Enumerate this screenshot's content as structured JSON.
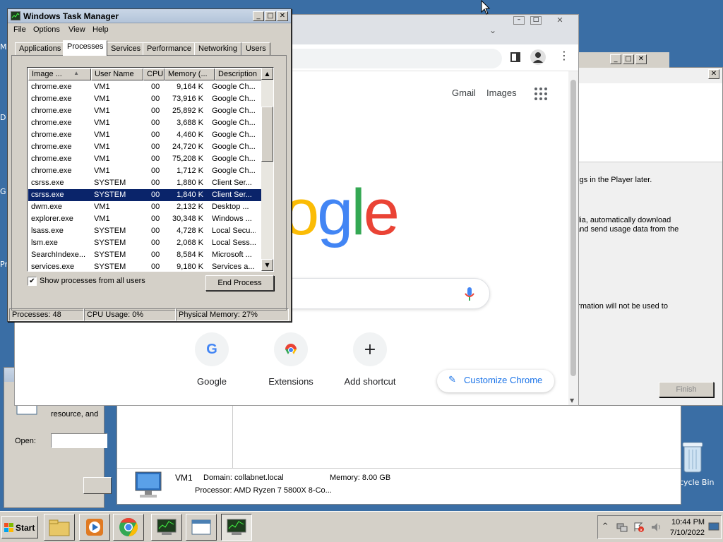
{
  "task_manager": {
    "title": "Windows Task Manager",
    "menu": [
      "File",
      "Options",
      "View",
      "Help"
    ],
    "tabs": [
      "Applications",
      "Processes",
      "Services",
      "Performance",
      "Networking",
      "Users"
    ],
    "columns": [
      "Image ...",
      "User Name",
      "CPU",
      "Memory (...",
      "Description"
    ],
    "processes": [
      {
        "image": "chrome.exe",
        "user": "VM1",
        "cpu": "00",
        "memory": "9,164 K",
        "description": "Google Ch..."
      },
      {
        "image": "chrome.exe",
        "user": "VM1",
        "cpu": "00",
        "memory": "73,916 K",
        "description": "Google Ch..."
      },
      {
        "image": "chrome.exe",
        "user": "VM1",
        "cpu": "00",
        "memory": "25,892 K",
        "description": "Google Ch..."
      },
      {
        "image": "chrome.exe",
        "user": "VM1",
        "cpu": "00",
        "memory": "3,688 K",
        "description": "Google Ch..."
      },
      {
        "image": "chrome.exe",
        "user": "VM1",
        "cpu": "00",
        "memory": "4,460 K",
        "description": "Google Ch..."
      },
      {
        "image": "chrome.exe",
        "user": "VM1",
        "cpu": "00",
        "memory": "24,720 K",
        "description": "Google Ch..."
      },
      {
        "image": "chrome.exe",
        "user": "VM1",
        "cpu": "00",
        "memory": "75,208 K",
        "description": "Google Ch..."
      },
      {
        "image": "chrome.exe",
        "user": "VM1",
        "cpu": "00",
        "memory": "1,712 K",
        "description": "Google Ch..."
      },
      {
        "image": "csrss.exe",
        "user": "SYSTEM",
        "cpu": "00",
        "memory": "1,880 K",
        "description": "Client Ser..."
      },
      {
        "image": "csrss.exe",
        "user": "SYSTEM",
        "cpu": "00",
        "memory": "1,840 K",
        "description": "Client Ser..."
      },
      {
        "image": "dwm.exe",
        "user": "VM1",
        "cpu": "00",
        "memory": "2,132 K",
        "description": "Desktop ..."
      },
      {
        "image": "explorer.exe",
        "user": "VM1",
        "cpu": "00",
        "memory": "30,348 K",
        "description": "Windows ..."
      },
      {
        "image": "lsass.exe",
        "user": "SYSTEM",
        "cpu": "00",
        "memory": "4,728 K",
        "description": "Local Secu..."
      },
      {
        "image": "lsm.exe",
        "user": "SYSTEM",
        "cpu": "00",
        "memory": "2,068 K",
        "description": "Local Sess..."
      },
      {
        "image": "SearchIndexe...",
        "user": "SYSTEM",
        "cpu": "00",
        "memory": "8,584 K",
        "description": "Microsoft ..."
      },
      {
        "image": "services.exe",
        "user": "SYSTEM",
        "cpu": "00",
        "memory": "9,180 K",
        "description": "Services a..."
      }
    ],
    "selected_row": 9,
    "show_all_label": "Show processes from all users",
    "show_all_checked": true,
    "end_process_label": "End Process",
    "status": {
      "processes": "Processes: 48",
      "cpu": "CPU Usage: 0%",
      "memory": "Physical Memory: 27%"
    }
  },
  "chrome": {
    "gmail_link": "Gmail",
    "images_link": "Images",
    "logo_visible": "ogle",
    "shortcuts": [
      {
        "label": "Google",
        "icon": "google-g-icon"
      },
      {
        "label": "Extensions",
        "icon": "chrome-web-store-icon"
      },
      {
        "label": "Add shortcut",
        "icon": "plus-icon"
      }
    ],
    "customize_label": "Customize Chrome"
  },
  "wizard": {
    "line1": "tings in the Player later.",
    "line2": "edia, automatically download",
    "line3": ", and send usage data from the",
    "line4": "formation will not be used to",
    "finish_label": "Finish"
  },
  "explorer_details": {
    "computer_name": "VM1",
    "domain": "Domain: collabnet.local",
    "memory": "Memory: 8.00 GB",
    "processor": "Processor: AMD Ryzen 7 5800X 8-Co..."
  },
  "run_dialog": {
    "text": "resource, and",
    "open_label": "Open:"
  },
  "desktop": {
    "recycle_bin_label": "cycle Bin"
  },
  "taskbar": {
    "start_label": "Start",
    "time": "10:44 PM",
    "date": "7/10/2022"
  },
  "colors": {
    "desktop": "#3a6ea5",
    "selection": "#0a246a",
    "chrome_blue": "#1a73e8"
  }
}
